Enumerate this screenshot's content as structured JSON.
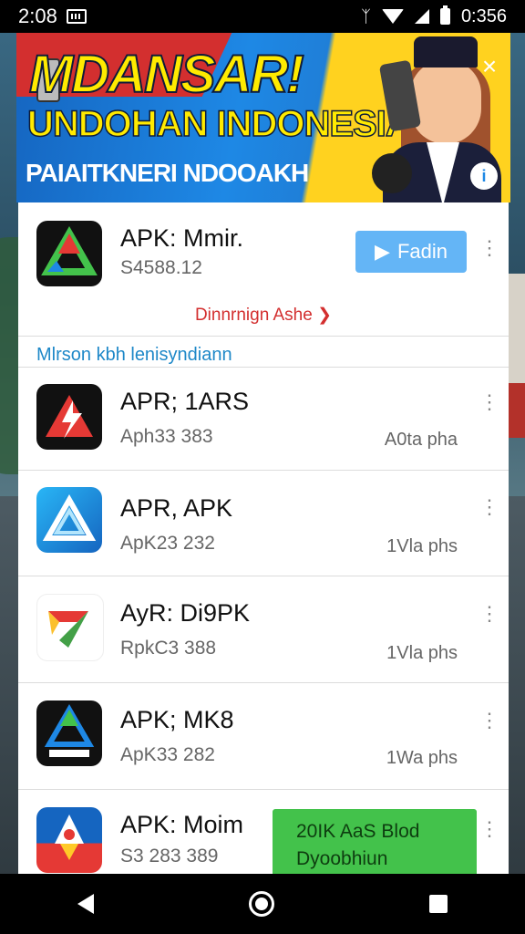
{
  "statusbar": {
    "time": "2:08",
    "clock_right": "0:356"
  },
  "banner": {
    "title": "MDANSAR!",
    "subtitle": "UNDOHAN INDONESIA",
    "tagline": "PAIAITKNERI NDOOAKH",
    "close_glyph": "×",
    "info_glyph": "i"
  },
  "apps": [
    {
      "name": "APK: Mmir.",
      "sub": "S4588.12",
      "size": "",
      "icon": "triangle-logo-icon"
    },
    {
      "name": "APR; 1ARS",
      "sub": "Aph33 383",
      "size": "A0ta pha",
      "icon": "red-swoosh-logo-icon"
    },
    {
      "name": "APR, APK",
      "sub": "ApK23 232",
      "size": "1Vla phs",
      "icon": "blue-triangle-logo-icon"
    },
    {
      "name": "AyR: Di9PK",
      "sub": "RpkC3 388",
      "size": "1Vla phs",
      "icon": "colorful-triangle-logo-icon"
    },
    {
      "name": "APK; MK8",
      "sub": "ApK33 282",
      "size": "1Wa phs",
      "icon": "dark-triangle-logo-icon"
    },
    {
      "name": "APK: Moim",
      "sub": "S3 283 389",
      "size": "",
      "icon": "rocket-logo-icon"
    }
  ],
  "fetch_button": {
    "label": "Fadin",
    "glyph": "▶"
  },
  "notice": "Dinnrnign Ashe",
  "section_label": "Mlrson kbh lenisyndiann",
  "download_button": {
    "line1": "20IK AaS Blod",
    "line2": "Dyoobhiun"
  },
  "more_glyph": "⋮",
  "colors": {
    "accent": "#64b5f6",
    "download": "#43c24b",
    "notice": "#d32f2f",
    "section": "#1e88c8"
  }
}
